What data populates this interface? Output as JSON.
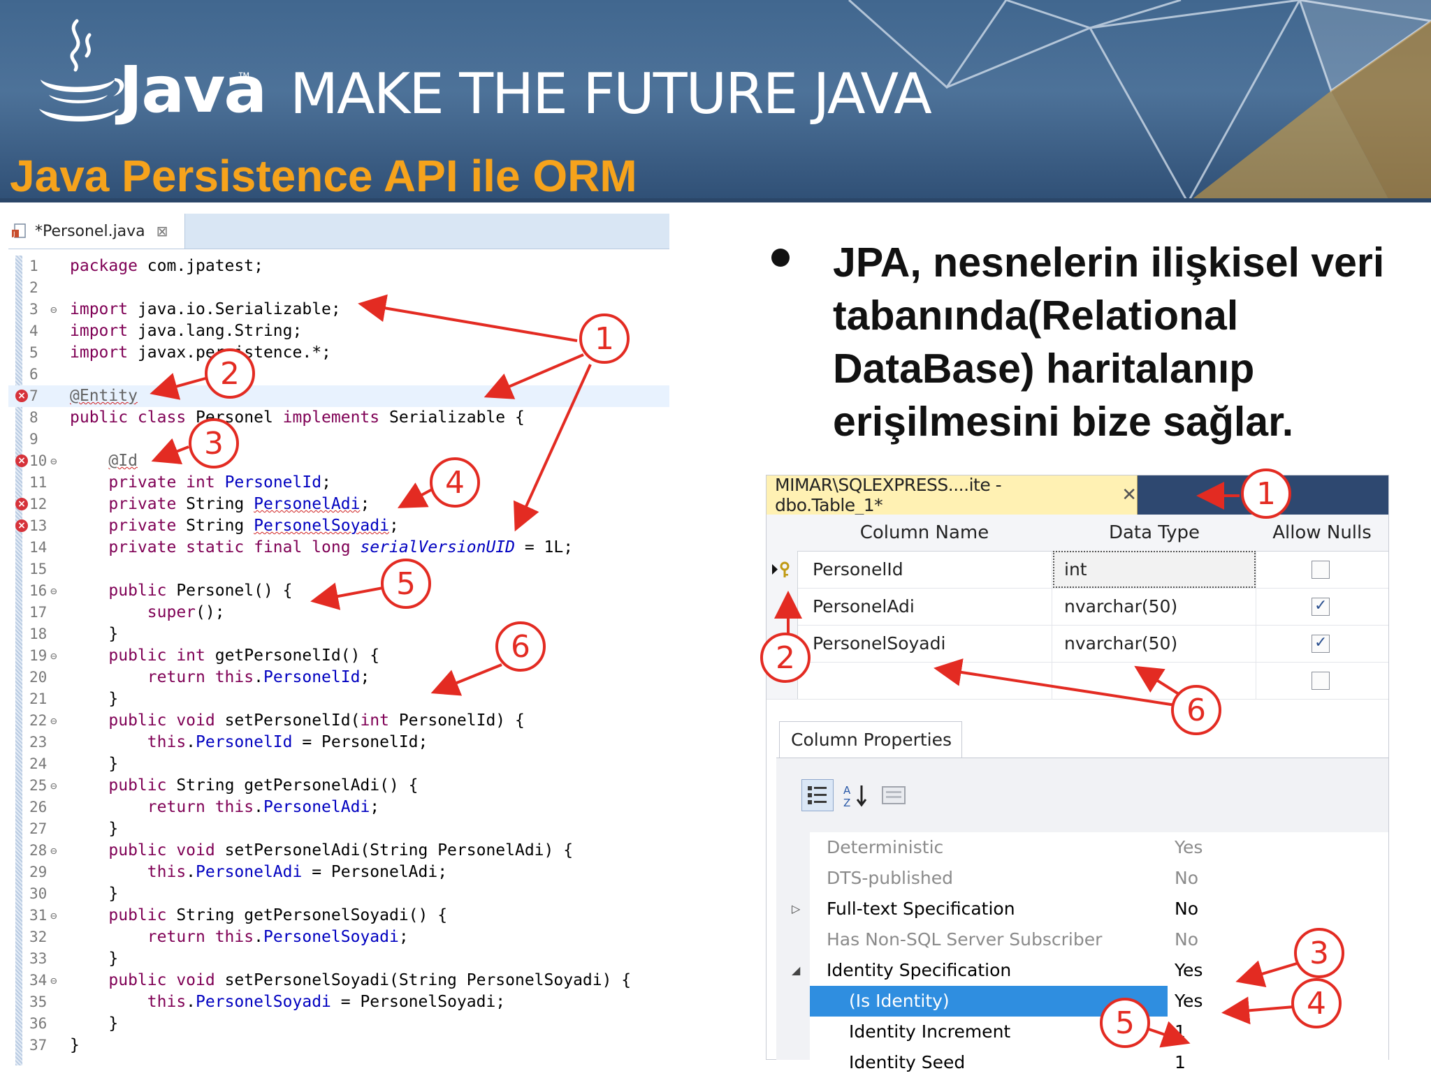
{
  "header": {
    "brand": "Java",
    "trademark": "™",
    "tagline": "MAKE THE FUTURE JAVA",
    "slide_title": "Java Persistence API ile ORM",
    "colors": {
      "banner": "#41678f",
      "title": "#f6a31c"
    }
  },
  "editor": {
    "tab_label": "*Personel.java",
    "tab_close": "⊠",
    "icons": [
      "java-file-icon",
      "error-marker-icon",
      "fold-toggle-icon"
    ]
  },
  "bullet": {
    "text": "JPA, nesnelerin ilişkisel veri tabanında(Relational DataBase) haritalanıp erişilmesini bize sağlar."
  },
  "sql": {
    "tab_label": "MIMAR\\SQLEXPRESS....ite - dbo.Table_1*",
    "tab_close": "✕",
    "columns": {
      "name": "Column Name",
      "type": "Data Type",
      "nulls": "Allow Nulls"
    },
    "rows": [
      {
        "name": "PersonelId",
        "type": "int",
        "nulls": false
      },
      {
        "name": "PersonelAdi",
        "type": "nvarchar(50)",
        "nulls": true
      },
      {
        "name": "PersonelSoyadi",
        "type": "nvarchar(50)",
        "nulls": true
      },
      {
        "name": "",
        "type": "",
        "nulls": false
      }
    ],
    "props_tab": "Column Properties",
    "props": [
      {
        "name": "Deterministic",
        "value": "Yes"
      },
      {
        "name": "DTS-published",
        "value": "No"
      },
      {
        "name": "Full-text Specification",
        "value": "No"
      },
      {
        "name": "Has Non-SQL Server Subscriber",
        "value": "No"
      },
      {
        "name": "Identity Specification",
        "value": "Yes"
      },
      {
        "name": "(Is Identity)",
        "value": "Yes"
      },
      {
        "name": "Identity Increment",
        "value": "1"
      },
      {
        "name": "Identity Seed",
        "value": "1"
      }
    ]
  },
  "callouts": [
    "1",
    "2",
    "3",
    "4",
    "5",
    "6"
  ],
  "accent_red": "#e32b22"
}
